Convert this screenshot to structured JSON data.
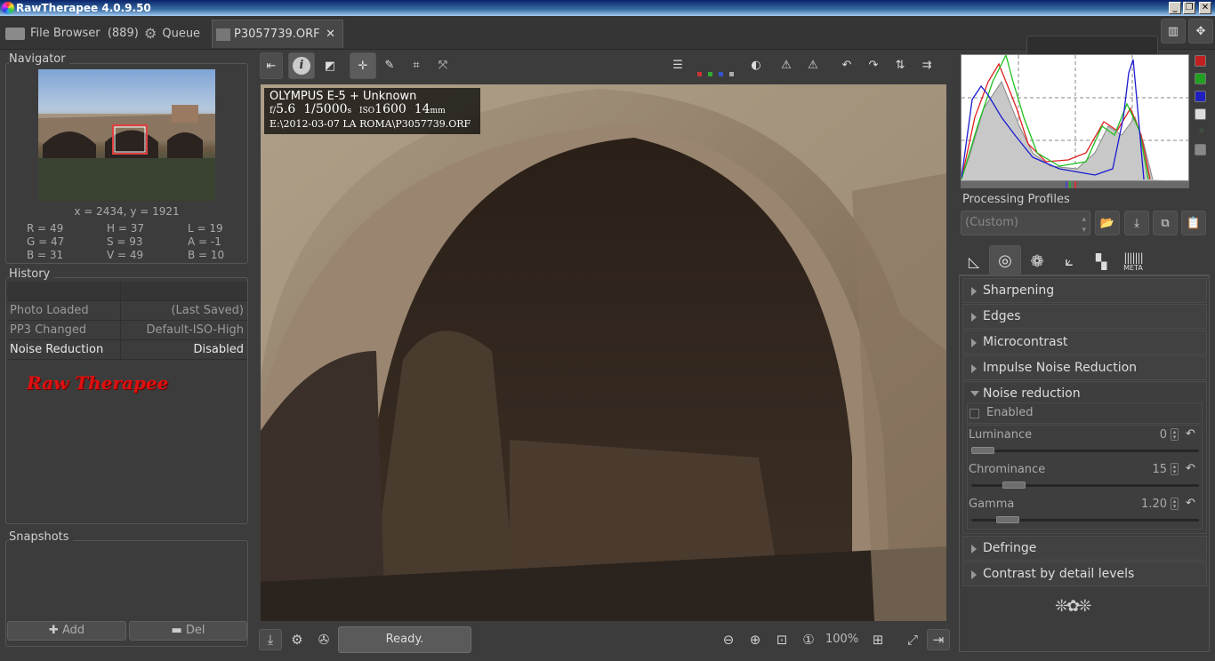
{
  "window": {
    "title": "RawTherapee 4.0.9.50",
    "buttons": [
      "_",
      "❐",
      "✕"
    ]
  },
  "tabs": [
    {
      "label": "File Browser",
      "count": "(889)",
      "icon": "folder-icon"
    },
    {
      "label": "Queue",
      "icon": "gears-icon"
    },
    {
      "label": "P3057739.ORF",
      "icon": "image-icon",
      "close": "✕"
    }
  ],
  "navigator": {
    "title": "Navigator",
    "coords": "x = 2434, y = 1921",
    "values": [
      [
        "R = 49",
        "H = 37",
        "L = 19"
      ],
      [
        "G = 47",
        "S = 93",
        "A = -1"
      ],
      [
        "B = 31",
        "V = 49",
        "B = 10"
      ]
    ]
  },
  "history": {
    "title": "History",
    "rows": [
      {
        "action": "Photo Loaded",
        "value": "(Last Saved)"
      },
      {
        "action": "PP3 Changed",
        "value": "Default-ISO-High"
      },
      {
        "action": "Noise Reduction",
        "value": "Disabled",
        "selected": true
      }
    ],
    "watermark": "Raw Therapee"
  },
  "snapshots": {
    "title": "Snapshots",
    "add": "Add",
    "del": "Del"
  },
  "image_info": {
    "camera": "OLYMPUS E-5 + Unknown",
    "aperture_prefix": "f/",
    "aperture": "5.6",
    "shutter": "1/5000",
    "shutter_unit": "s",
    "iso_prefix": "ISO",
    "iso": "1600",
    "focal": "14",
    "focal_unit": "mm",
    "path": "E:\\2012-03-07 LA ROMA\\P3057739.ORF"
  },
  "status": {
    "text": "Ready.",
    "zoom": "100%"
  },
  "processing_profiles": {
    "title": "Processing Profiles",
    "selected": "(Custom)"
  },
  "tool_tabs": [
    "exposure-icon",
    "detail-icon",
    "color-icon",
    "transform-icon",
    "raw-icon",
    "metadata-icon"
  ],
  "tool_tab_meta_label": "META",
  "sections": [
    {
      "label": "Sharpening",
      "expanded": false
    },
    {
      "label": "Edges",
      "expanded": false
    },
    {
      "label": "Microcontrast",
      "expanded": false
    },
    {
      "label": "Impulse Noise Reduction",
      "expanded": false
    },
    {
      "label": "Noise reduction",
      "expanded": true
    },
    {
      "label": "Defringe",
      "expanded": false
    },
    {
      "label": "Contrast by detail levels",
      "expanded": false
    }
  ],
  "noise_reduction": {
    "enabled_label": "Enabled",
    "enabled": false,
    "sliders": [
      {
        "label": "Luminance",
        "value": "0",
        "fraction": 0.0
      },
      {
        "label": "Chrominance",
        "value": "15",
        "fraction": 0.15
      },
      {
        "label": "Gamma",
        "value": "1.20",
        "fraction": 0.12
      }
    ]
  },
  "colors": {
    "red": "#e02020",
    "green": "#20c020",
    "blue": "#1a1ad0",
    "watermark": "#e01010"
  }
}
